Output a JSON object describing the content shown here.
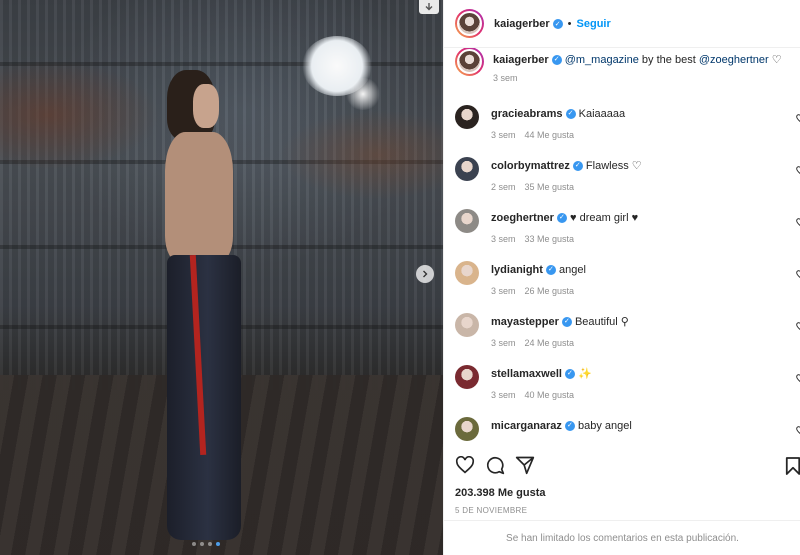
{
  "post": {
    "carousel_count": 4,
    "carousel_active_index": 3
  },
  "header": {
    "username": "kaiagerber",
    "separator": "•",
    "follow_label": "Seguir"
  },
  "caption": {
    "username": "kaiagerber",
    "mention1": "@m_magazine",
    "text_middle": " by the best ",
    "mention2": "@zoeghertner",
    "emoji": "♡",
    "time": "3 sem"
  },
  "comments": [
    {
      "username": "gracieabrams",
      "text": "Kaiaaaaa",
      "time": "3 sem",
      "likes": "44 Me gusta",
      "avatar_color": "#2a2320"
    },
    {
      "username": "colorbymattrez",
      "text": "Flawless ♡",
      "time": "2 sem",
      "likes": "35 Me gusta",
      "avatar_color": "#3b4250"
    },
    {
      "username": "zoeghertner",
      "text": "♥ dream girl ♥",
      "time": "3 sem",
      "likes": "33 Me gusta",
      "avatar_color": "#8d8a86"
    },
    {
      "username": "lydianight",
      "text": "angel",
      "time": "3 sem",
      "likes": "26 Me gusta",
      "avatar_color": "#d9b48c"
    },
    {
      "username": "mayastepper",
      "text": "Beautiful ⚲",
      "time": "3 sem",
      "likes": "24 Me gusta",
      "avatar_color": "#c9b6a8"
    },
    {
      "username": "stellamaxwell",
      "text": "✨",
      "time": "3 sem",
      "likes": "40 Me gusta",
      "avatar_color": "#7a2a30"
    },
    {
      "username": "micarganaraz",
      "text": "baby angel",
      "time": "",
      "likes": "",
      "avatar_color": "#6b6a3c"
    }
  ],
  "stats": {
    "likes": "203.398 Me gusta",
    "date": "5 DE NOVIEMBRE"
  },
  "footer": {
    "limited_text": "Se han limitado los comentarios en esta publicación."
  },
  "icons": {
    "heart": "heart-icon",
    "comment": "comment-icon",
    "share": "share-icon",
    "save": "bookmark-icon"
  },
  "colors": {
    "accent": "#0095f6",
    "verified": "#3897f0",
    "muted": "#8e8e8e"
  }
}
